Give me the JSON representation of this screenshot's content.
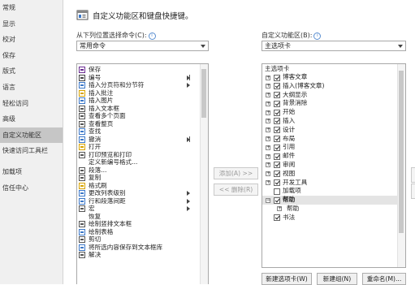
{
  "nav": {
    "items": [
      {
        "label": "常规",
        "selected": false
      },
      {
        "label": "显示",
        "selected": false
      },
      {
        "label": "校对",
        "selected": false
      },
      {
        "label": "保存",
        "selected": false
      },
      {
        "label": "版式",
        "selected": false
      },
      {
        "label": "语言",
        "selected": false
      },
      {
        "label": "轻松访问",
        "selected": false
      },
      {
        "label": "高级",
        "selected": false
      },
      {
        "label": "自定义功能区",
        "selected": true
      },
      {
        "label": "快速访问工具栏",
        "selected": false
      },
      {
        "label": "加载项",
        "selected": false
      },
      {
        "label": "信任中心",
        "selected": false
      }
    ]
  },
  "header": {
    "title": "自定义功能区和键盘快捷键。",
    "icon": "customize-ribbon-icon"
  },
  "left": {
    "label": "从下列位置选择命令(C):",
    "combo_value": "常用命令",
    "commands": [
      {
        "label": "保存",
        "icon": "save-icon",
        "marker": ""
      },
      {
        "label": "编号",
        "icon": "numbering-icon",
        "marker": "bar-submenu"
      },
      {
        "label": "插入分页符和分节符",
        "icon": "page-break-icon",
        "marker": "submenu"
      },
      {
        "label": "插入批注",
        "icon": "comment-icon",
        "marker": ""
      },
      {
        "label": "插入图片",
        "icon": "picture-icon",
        "marker": ""
      },
      {
        "label": "插入文本框",
        "icon": "textbox-icon",
        "marker": ""
      },
      {
        "label": "查看多个页面",
        "icon": "multi-page-icon",
        "marker": ""
      },
      {
        "label": "查看整页",
        "icon": "full-page-icon",
        "marker": ""
      },
      {
        "label": "查找",
        "icon": "find-icon",
        "marker": ""
      },
      {
        "label": "撤消",
        "icon": "undo-icon",
        "marker": "bar-submenu"
      },
      {
        "label": "打开",
        "icon": "open-icon",
        "marker": ""
      },
      {
        "label": "打印预览和打印",
        "icon": "print-preview-icon",
        "marker": ""
      },
      {
        "label": "定义新编号格式...",
        "icon": "",
        "marker": ""
      },
      {
        "label": "段落...",
        "icon": "paragraph-icon",
        "marker": ""
      },
      {
        "label": "复制",
        "icon": "copy-icon",
        "marker": ""
      },
      {
        "label": "格式刷",
        "icon": "format-painter-icon",
        "marker": ""
      },
      {
        "label": "更改列表级别",
        "icon": "list-level-icon",
        "marker": "submenu"
      },
      {
        "label": "行和段落间距",
        "icon": "line-spacing-icon",
        "marker": "submenu"
      },
      {
        "label": "宏",
        "icon": "macro-icon",
        "marker": "submenu"
      },
      {
        "label": "恢复",
        "icon": "",
        "marker": ""
      },
      {
        "label": "绘制竖排文本框",
        "icon": "vertical-textbox-icon",
        "marker": ""
      },
      {
        "label": "绘制表格",
        "icon": "draw-table-icon",
        "marker": ""
      },
      {
        "label": "剪切",
        "icon": "cut-icon",
        "marker": ""
      },
      {
        "label": "将所选内容保存到文本框库",
        "icon": "save-selection-icon",
        "marker": ""
      },
      {
        "label": "解决",
        "icon": "resolve-icon",
        "marker": ""
      }
    ]
  },
  "middle": {
    "add_label": "添加(A) >>",
    "remove_label": "<< 删除(R)"
  },
  "right": {
    "label": "自定义功能区(B):",
    "combo_value": "主选项卡",
    "tree_header": "主选项卡",
    "items": [
      {
        "label": "博客文章",
        "expander": "+",
        "checked": true,
        "level": 0
      },
      {
        "label": "插入(博客文章)",
        "expander": "+",
        "checked": true,
        "level": 0
      },
      {
        "label": "大纲显示",
        "expander": "+",
        "checked": true,
        "level": 0
      },
      {
        "label": "背景消除",
        "expander": "+",
        "checked": true,
        "level": 0
      },
      {
        "label": "开始",
        "expander": "+",
        "checked": true,
        "level": 0
      },
      {
        "label": "插入",
        "expander": "+",
        "checked": true,
        "level": 0
      },
      {
        "label": "设计",
        "expander": "+",
        "checked": true,
        "level": 0
      },
      {
        "label": "布局",
        "expander": "+",
        "checked": true,
        "level": 0
      },
      {
        "label": "引用",
        "expander": "+",
        "checked": true,
        "level": 0
      },
      {
        "label": "邮件",
        "expander": "+",
        "checked": true,
        "level": 0
      },
      {
        "label": "审阅",
        "expander": "+",
        "checked": true,
        "level": 0
      },
      {
        "label": "视图",
        "expander": "+",
        "checked": true,
        "level": 0
      },
      {
        "label": "开发工具",
        "expander": "+",
        "checked": true,
        "level": 0
      },
      {
        "label": "加载项",
        "expander": "",
        "checked": false,
        "level": 0
      },
      {
        "label": "帮助",
        "expander": "-",
        "checked": true,
        "level": 0
      },
      {
        "label": "帮助",
        "expander": "+",
        "checked": null,
        "level": 1
      },
      {
        "label": "书法",
        "expander": "",
        "checked": true,
        "level": 0
      }
    ]
  },
  "bottom": {
    "new_tab": "新建选项卡(W)",
    "new_group": "新建组(N)",
    "rename": "重命名(M)..."
  }
}
